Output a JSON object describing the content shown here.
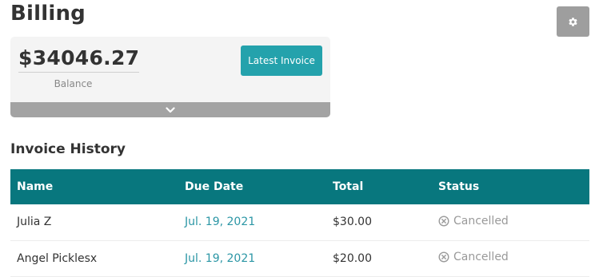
{
  "header": {
    "title": "Billing",
    "settings_icon": "gear-icon"
  },
  "balance": {
    "amount": "$34046.27",
    "label": "Balance",
    "latest_invoice_label": "Latest Invoice",
    "expand_icon": "chevron-down-icon"
  },
  "invoices": {
    "title": "Invoice History",
    "columns": [
      "Name",
      "Due Date",
      "Total",
      "Status"
    ],
    "rows": [
      {
        "name": "Julia Z",
        "due_date": "Jul. 19, 2021",
        "total": "$30.00",
        "status": "Cancelled"
      },
      {
        "name": "Angel Picklesx",
        "due_date": "Jul. 19, 2021",
        "total": "$20.00",
        "status": "Cancelled"
      }
    ],
    "status_icon": "cancel-circle-icon"
  },
  "colors": {
    "table_header": "#08777e",
    "button_teal": "#24a2ac",
    "link": "#2b96a5",
    "settings_button": "#9e9e9e",
    "card_bg": "#f4f4f4",
    "expand_bar": "#a3a3a3",
    "muted_text": "#999999"
  }
}
